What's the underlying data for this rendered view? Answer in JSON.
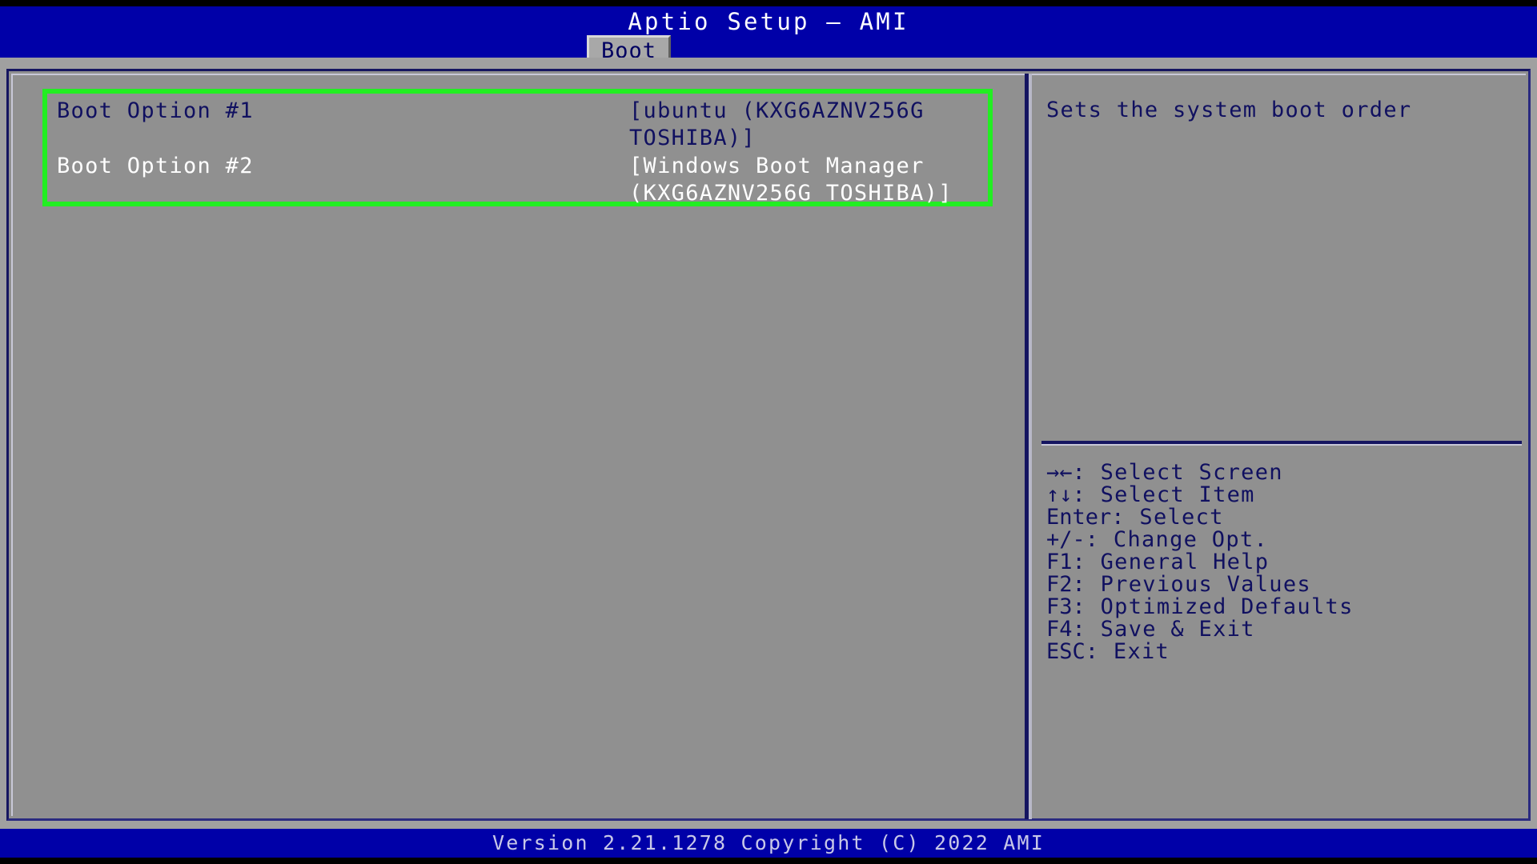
{
  "window": {
    "title": "Aptio Setup – AMI"
  },
  "tabs": [
    {
      "label": "Boot",
      "active": true
    }
  ],
  "boot_options": [
    {
      "label": "Boot Option #1",
      "value": "[ubuntu (KXG6AZNV256G\nTOSHIBA)]",
      "selected": true
    },
    {
      "label": "Boot Option #2",
      "value": "[Windows Boot Manager\n(KXG6AZNV256G TOSHIBA)]",
      "selected": false
    }
  ],
  "help": {
    "text": "Sets the system boot order"
  },
  "legend": [
    {
      "key": "→←",
      "label": ": Select Screen"
    },
    {
      "key": "↑↓",
      "label": ": Select Item"
    },
    {
      "key": "Enter",
      "label": ": Select"
    },
    {
      "key": "+/-",
      "label": ": Change Opt."
    },
    {
      "key": "F1",
      "label": ": General Help"
    },
    {
      "key": "F2",
      "label": ": Previous Values"
    },
    {
      "key": "F3",
      "label": ": Optimized Defaults"
    },
    {
      "key": "F4",
      "label": ": Save & Exit"
    },
    {
      "key": "ESC",
      "label": ": Exit"
    }
  ],
  "footer": {
    "version_text": "Version 2.21.1278 Copyright (C) 2022 AMI"
  },
  "colors": {
    "header_blue": "#0000a8",
    "panel_gray": "#909090",
    "highlight_green": "#22ee22",
    "text_navy": "#101060",
    "text_white": "#ffffff"
  }
}
